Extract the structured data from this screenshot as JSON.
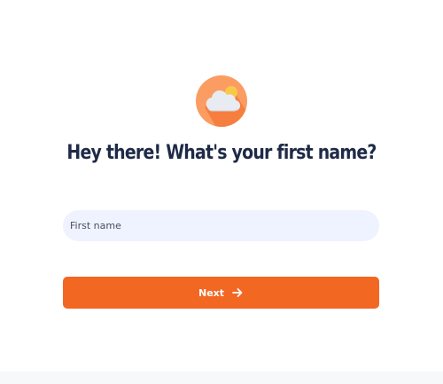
{
  "header": {
    "logo_icon": "cloud-sun-icon",
    "title": "Hey there! What's your first name?"
  },
  "form": {
    "first_name": {
      "placeholder": "First name",
      "value": ""
    },
    "next_button": {
      "label": "Next",
      "icon": "arrow-right-icon"
    }
  },
  "colors": {
    "accent": "#f26722",
    "logo_circle": "#fb9c62",
    "title_text": "#1e2a47",
    "input_background": "#eef3ff"
  }
}
